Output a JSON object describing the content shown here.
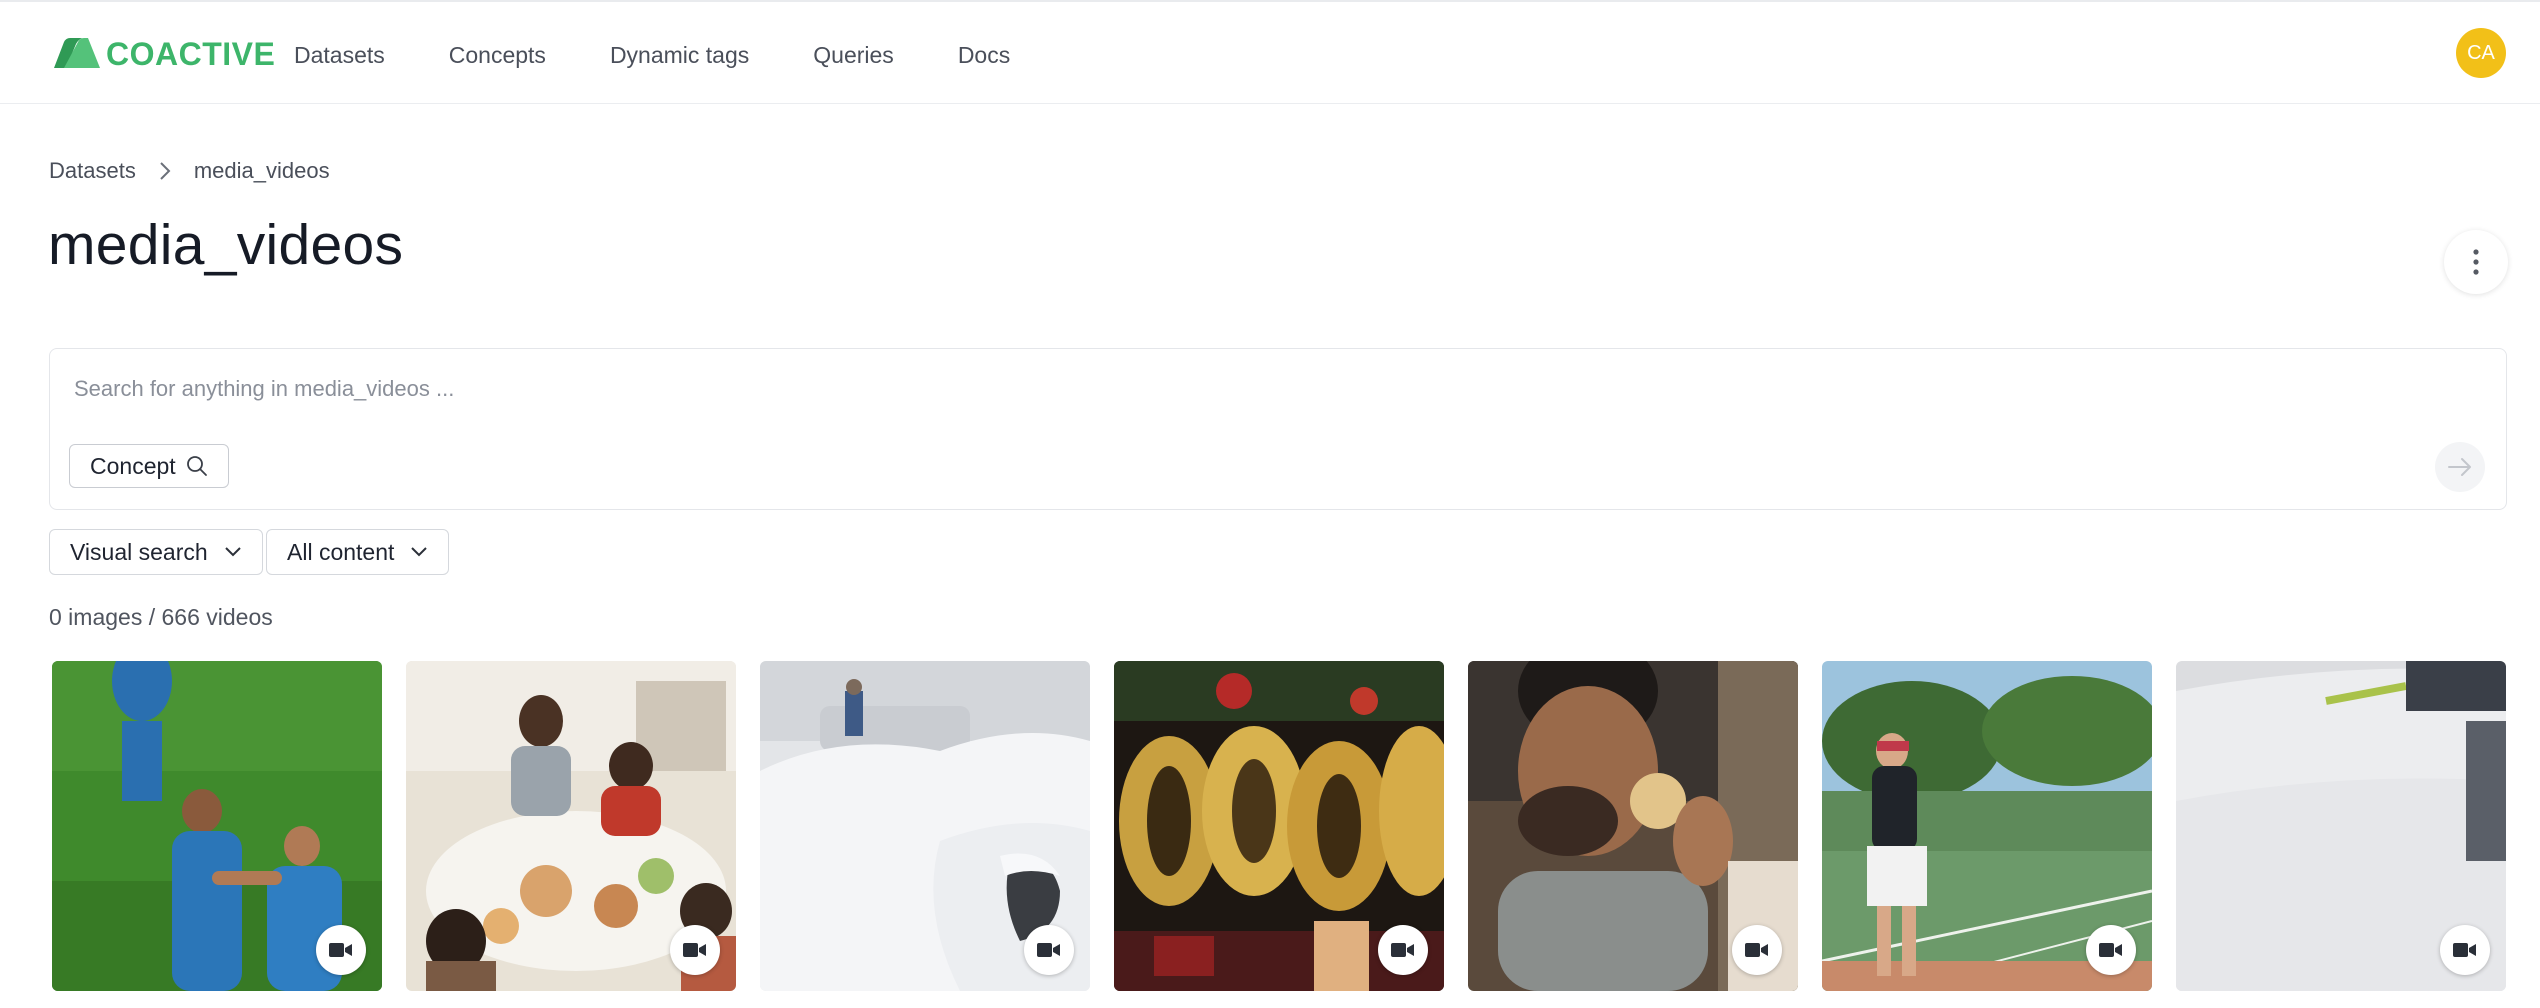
{
  "app": {
    "logo_text": "COACTIVE",
    "brand_color": "#3db56a",
    "nav": [
      {
        "label": "Datasets"
      },
      {
        "label": "Concepts"
      },
      {
        "label": "Dynamic tags"
      },
      {
        "label": "Queries"
      },
      {
        "label": "Docs"
      }
    ],
    "avatar_initials": "CA",
    "avatar_color": "#f2c018"
  },
  "breadcrumb": {
    "root": "Datasets",
    "current": "media_videos"
  },
  "page": {
    "title": "media_videos"
  },
  "search": {
    "placeholder": "Search for anything in media_videos ...",
    "value": "",
    "concept_chip_label": "Concept"
  },
  "filters": {
    "search_mode": "Visual search",
    "content_type": "All content"
  },
  "results": {
    "count_text": "0 images / 666 videos",
    "items": [
      {
        "subject": "soccer players celebrating on field",
        "icon": "video-camera-icon"
      },
      {
        "subject": "family dinner at table",
        "icon": "video-camera-icon"
      },
      {
        "subject": "snow covered car",
        "icon": "video-camera-icon"
      },
      {
        "subject": "gold 2020 balloons",
        "icon": "video-camera-icon"
      },
      {
        "subject": "man eating pastry",
        "icon": "video-camera-icon"
      },
      {
        "subject": "tennis player on court",
        "icon": "video-camera-icon"
      },
      {
        "subject": "brushing snow off car",
        "icon": "video-camera-icon"
      }
    ]
  }
}
